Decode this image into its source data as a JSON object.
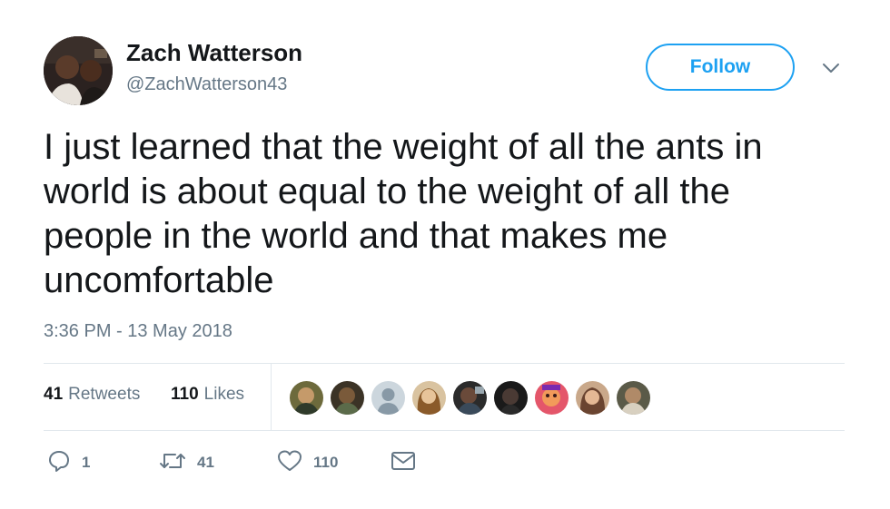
{
  "author": {
    "display_name": "Zach Watterson",
    "screen_name": "@ZachWatterson43"
  },
  "follow_button": {
    "label": "Follow"
  },
  "tweet": {
    "text": "I just learned that the weight of all the ants in\nworld is about equal to the weight of all the\npeople in the world and that makes me\nuncomfortable",
    "timestamp": "3:36 PM - 13 May 2018"
  },
  "stats": {
    "retweets_count": "41",
    "retweets_label": "Retweets",
    "likes_count": "110",
    "likes_label": "Likes"
  },
  "actions": {
    "reply_count": "1",
    "retweet_count": "41",
    "like_count": "110"
  },
  "colors": {
    "brand_blue": "#1da1f2",
    "secondary_text": "#657786",
    "primary_text": "#14171a",
    "divider": "#e1e8ed"
  },
  "icons": {
    "reply": "reply-icon",
    "retweet": "retweet-icon",
    "like": "heart-icon",
    "dm": "envelope-icon",
    "more": "chevron-down-icon"
  }
}
